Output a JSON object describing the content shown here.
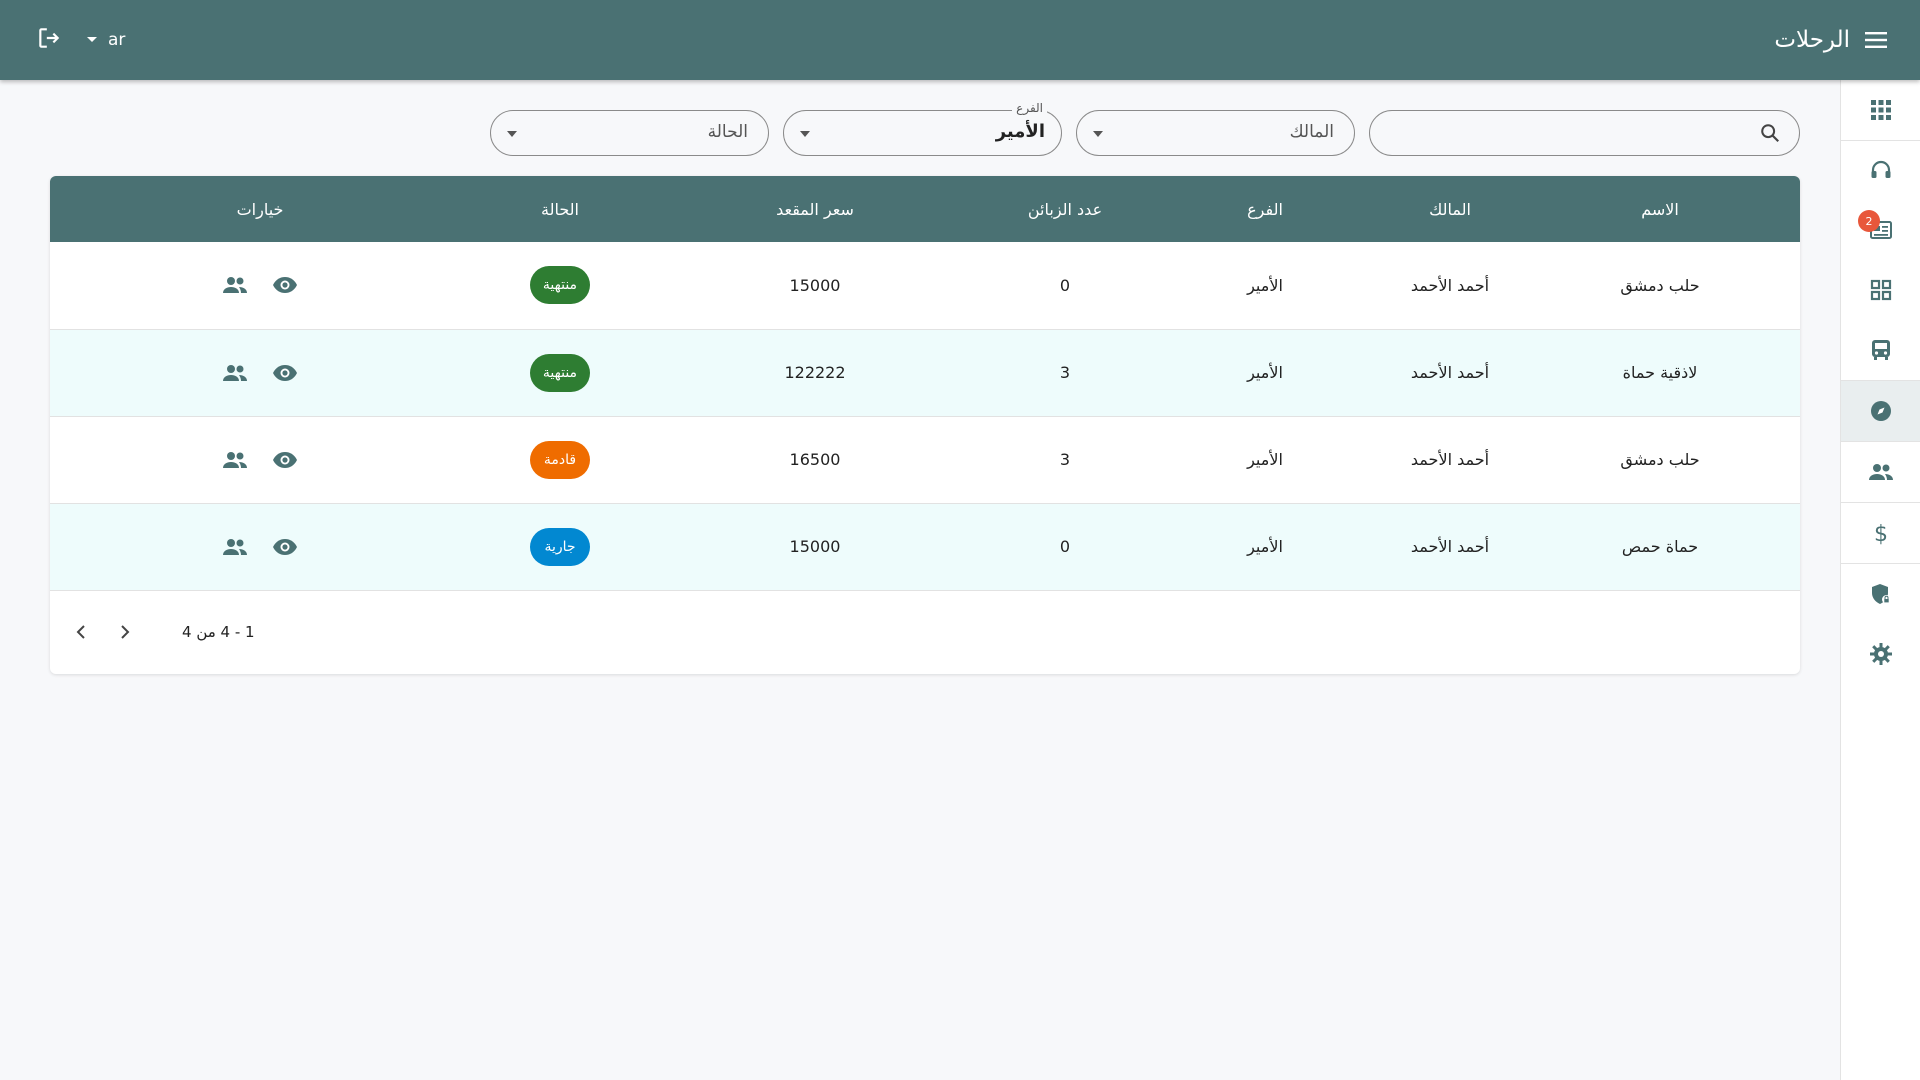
{
  "header": {
    "title": "الرحلات",
    "language": "ar"
  },
  "sidebar": {
    "badge_count": "2"
  },
  "filters": {
    "search_placeholder": "",
    "owner_label": "المالك",
    "branch_label": "الفرع",
    "branch_value": "الأمير",
    "status_label": "الحالة"
  },
  "table": {
    "headers": [
      "الاسم",
      "المالك",
      "الفرع",
      "عدد الزبائن",
      "سعر المقعد",
      "الحالة",
      "خيارات"
    ],
    "rows": [
      {
        "name": "حلب دمشق",
        "owner": "أحمد الأحمد",
        "branch": "الأمير",
        "customers": "0",
        "price": "15000",
        "status": "منتهية",
        "status_color": "#2e7d32"
      },
      {
        "name": "لاذقية حماة",
        "owner": "أحمد الأحمد",
        "branch": "الأمير",
        "customers": "3",
        "price": "122222",
        "status": "منتهية",
        "status_color": "#2e7d32"
      },
      {
        "name": "حلب دمشق",
        "owner": "أحمد الأحمد",
        "branch": "الأمير",
        "customers": "3",
        "price": "16500",
        "status": "قادمة",
        "status_color": "#ef6c00"
      },
      {
        "name": "حماة حمص",
        "owner": "أحمد الأحمد",
        "branch": "الأمير",
        "customers": "0",
        "price": "15000",
        "status": "جارية",
        "status_color": "#0288d1"
      }
    ]
  },
  "pagination": {
    "range": "1 - 4 من 4"
  },
  "colors": {
    "primary": "#4a7173",
    "alt_row": "#eefcfc",
    "badge": "#e8573b"
  }
}
